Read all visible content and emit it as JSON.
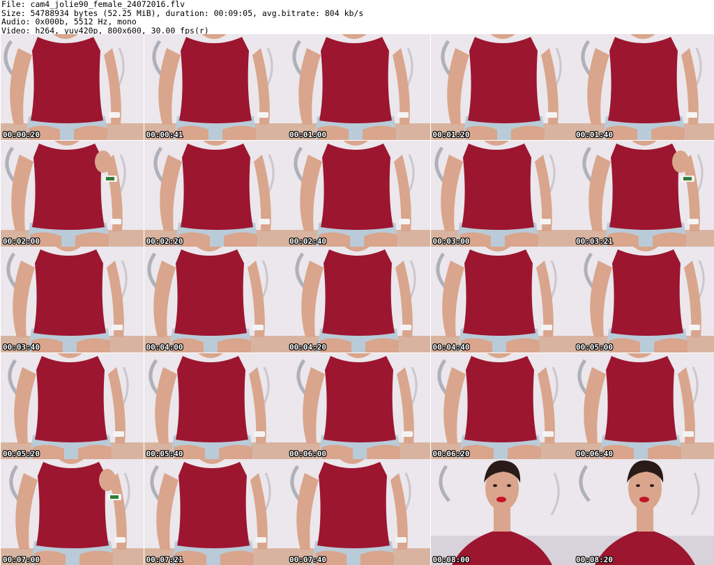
{
  "info": {
    "file": "File: cam4_jolie90_female_24072016.flv",
    "size": "Size: 54788934 bytes (52.25 MiB), duration: 00:09:05, avg.bitrate: 804 kb/s",
    "audio": "Audio: 0x000b, 5512 Hz, mono",
    "video": "Video: h264, yuv420p, 800x600, 30.00 fps(r)"
  },
  "thumbnails": [
    {
      "time": "00:00:20",
      "scene": "torso"
    },
    {
      "time": "00:00:41",
      "scene": "torso"
    },
    {
      "time": "00:01:00",
      "scene": "torso"
    },
    {
      "time": "00:01:20",
      "scene": "torso"
    },
    {
      "time": "00:01:40",
      "scene": "torso"
    },
    {
      "time": "00:02:00",
      "scene": "torso-hand"
    },
    {
      "time": "00:02:20",
      "scene": "torso"
    },
    {
      "time": "00:02:40",
      "scene": "torso"
    },
    {
      "time": "00:03:00",
      "scene": "torso"
    },
    {
      "time": "00:03:21",
      "scene": "torso-hand"
    },
    {
      "time": "00:03:40",
      "scene": "torso"
    },
    {
      "time": "00:04:00",
      "scene": "torso"
    },
    {
      "time": "00:04:20",
      "scene": "torso"
    },
    {
      "time": "00:04:40",
      "scene": "torso"
    },
    {
      "time": "00:05:00",
      "scene": "torso"
    },
    {
      "time": "00:05:20",
      "scene": "torso"
    },
    {
      "time": "00:05:40",
      "scene": "torso"
    },
    {
      "time": "00:06:00",
      "scene": "torso"
    },
    {
      "time": "00:06:20",
      "scene": "torso"
    },
    {
      "time": "00:06:40",
      "scene": "torso"
    },
    {
      "time": "00:07:00",
      "scene": "torso-hand"
    },
    {
      "time": "00:07:21",
      "scene": "torso"
    },
    {
      "time": "00:07:40",
      "scene": "torso"
    },
    {
      "time": "00:08:00",
      "scene": "face"
    },
    {
      "time": "00:08:20",
      "scene": "face"
    }
  ],
  "colors": {
    "shirt": "#9c1630",
    "skin": "#d9a58c",
    "wall": "#ebe7ec",
    "denim": "#b9cbd8",
    "desk": "#c98a62"
  }
}
